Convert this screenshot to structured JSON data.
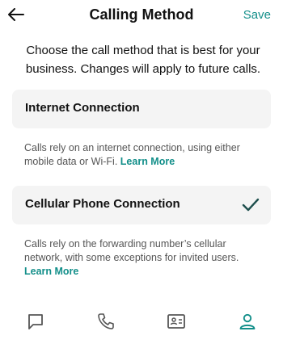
{
  "header": {
    "title": "Calling Method",
    "save_label": "Save",
    "back_icon": "arrow-left-icon"
  },
  "intro_text": "Choose the call method that is best for your business. Changes will apply to future calls.",
  "options": [
    {
      "label": "Internet Connection",
      "selected": false,
      "description": "Calls rely on an internet connection, using either mobile data or Wi-Fi.",
      "link_label": "Learn More"
    },
    {
      "label": "Cellular Phone Connection",
      "selected": true,
      "description": "Calls rely on the forwarding number’s cellular network, with some exceptions for invited users.",
      "link_label": "Learn More"
    }
  ],
  "nav": [
    {
      "icon": "chat-bubble-icon",
      "active": false
    },
    {
      "icon": "phone-icon",
      "active": false
    },
    {
      "icon": "contact-card-icon",
      "active": false
    },
    {
      "icon": "person-icon",
      "active": true
    }
  ],
  "colors": {
    "accent": "#138f8a",
    "card_bg": "#f4f4f4",
    "nav_inactive": "#555555"
  }
}
